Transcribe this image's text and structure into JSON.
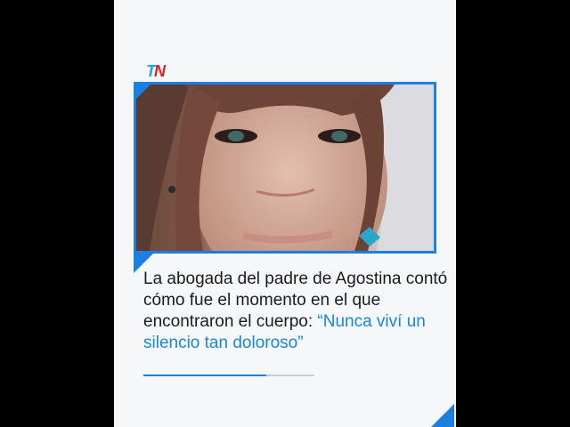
{
  "brand": {
    "logo_t": "T",
    "logo_n": "N"
  },
  "article": {
    "headline_plain": "La abogada del padre de Agostina contó cómo fue el momento en el que encontraron el cuerpo: ",
    "headline_quote": "“Nunca viví un silencio tan doloroso”"
  },
  "colors": {
    "accent": "#1a7fe0",
    "quote": "#1a86d8",
    "logo_blue": "#1aa6e8",
    "logo_red": "#e31e24"
  }
}
